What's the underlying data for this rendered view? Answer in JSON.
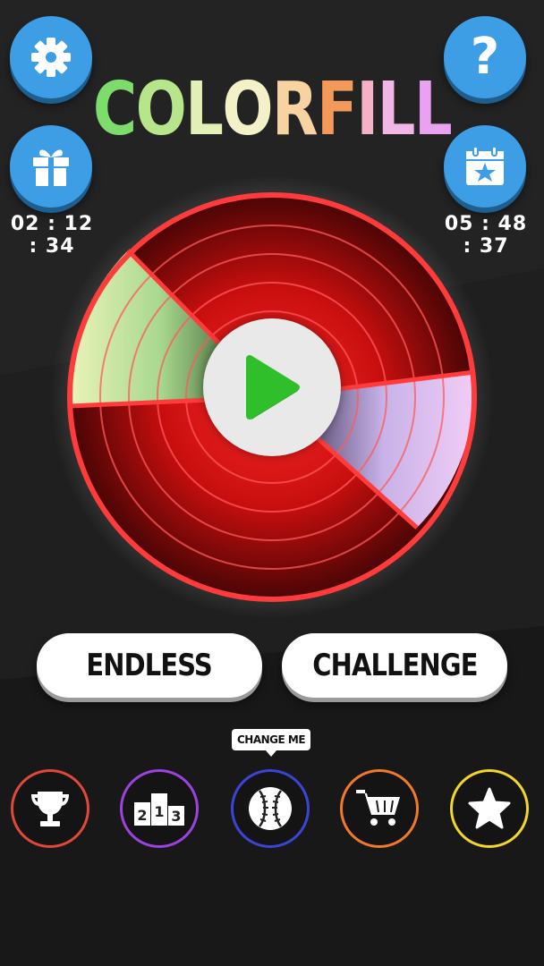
{
  "app": {
    "logo_letters": [
      {
        "ch": "C",
        "color": "#7ddc6b"
      },
      {
        "ch": "O",
        "color": "#b6e58c"
      },
      {
        "ch": "L",
        "color": "#e3f0b5"
      },
      {
        "ch": "O",
        "color": "#f4f1c8"
      },
      {
        "ch": "R",
        "color": "#f6d3a0"
      },
      {
        "ch": "F",
        "color": "#f39a5a"
      },
      {
        "ch": "I",
        "color": "#f5b2c6"
      },
      {
        "ch": "L",
        "color": "#f2b6e6"
      },
      {
        "ch": "L",
        "color": "#e8a2ef"
      }
    ]
  },
  "top_left": {
    "settings_icon": "gear-icon",
    "gift_icon": "gift-icon",
    "gift_timer": "02 : 12 : 34"
  },
  "top_right": {
    "help_icon": "question-icon",
    "help_label": "?",
    "daily_icon": "calendar-star-icon",
    "daily_timer": "05 : 48 : 37"
  },
  "wheel": {
    "play_icon": "play-icon",
    "accent_red": "#e01818",
    "segment_colors": [
      "#b8e39a",
      "#d9b6ec"
    ]
  },
  "modes": {
    "endless_label": "ENDLESS",
    "challenge_label": "CHALLENGE"
  },
  "bottom_bar": {
    "tooltip": "CHANGE ME",
    "items": [
      {
        "name": "trophy-icon",
        "color": "#e0483a"
      },
      {
        "name": "leaderboard-icon",
        "color": "#9b42e0",
        "ranks": [
          "2",
          "1",
          "3"
        ]
      },
      {
        "name": "ball-icon",
        "color": "#3c44d8"
      },
      {
        "name": "cart-icon",
        "color": "#f07a2a"
      },
      {
        "name": "star-icon",
        "color": "#f2d62a"
      }
    ]
  }
}
